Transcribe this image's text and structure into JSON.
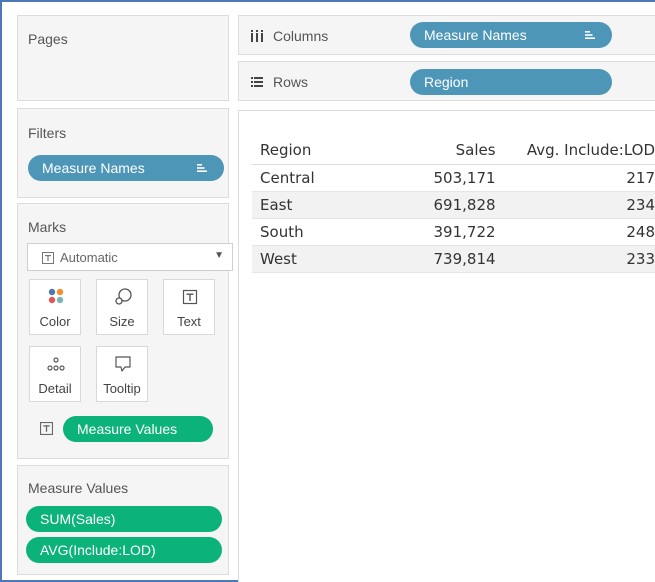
{
  "pages": {
    "title": "Pages"
  },
  "filters": {
    "title": "Filters",
    "pill": "Measure Names"
  },
  "marks": {
    "title": "Marks",
    "type_selected": "Automatic",
    "cards": [
      {
        "label": "Color",
        "icon": "color-dots-icon"
      },
      {
        "label": "Size",
        "icon": "size-icon"
      },
      {
        "label": "Text",
        "icon": "text-icon"
      },
      {
        "label": "Detail",
        "icon": "detail-icon"
      },
      {
        "label": "Tooltip",
        "icon": "tooltip-icon"
      }
    ],
    "text_pill": "Measure Values"
  },
  "measure_values": {
    "title": "Measure Values",
    "pills": [
      "SUM(Sales)",
      "AVG(Include:LOD)"
    ]
  },
  "shelves": {
    "columns_label": "Columns",
    "columns_pill": "Measure Names",
    "rows_label": "Rows",
    "rows_pill": "Region"
  },
  "view": {
    "headers": [
      "Region",
      "Sales",
      "Avg. Include:LOD"
    ],
    "rows": [
      [
        "Central",
        "503,171",
        "217"
      ],
      [
        "East",
        "691,828",
        "234"
      ],
      [
        "South",
        "391,722",
        "248"
      ],
      [
        "West",
        "739,814",
        "233"
      ]
    ]
  },
  "colors": {
    "blue_pill": "#4e96b8",
    "green_pill": "#0bb27a",
    "frame": "#4a78b8"
  }
}
